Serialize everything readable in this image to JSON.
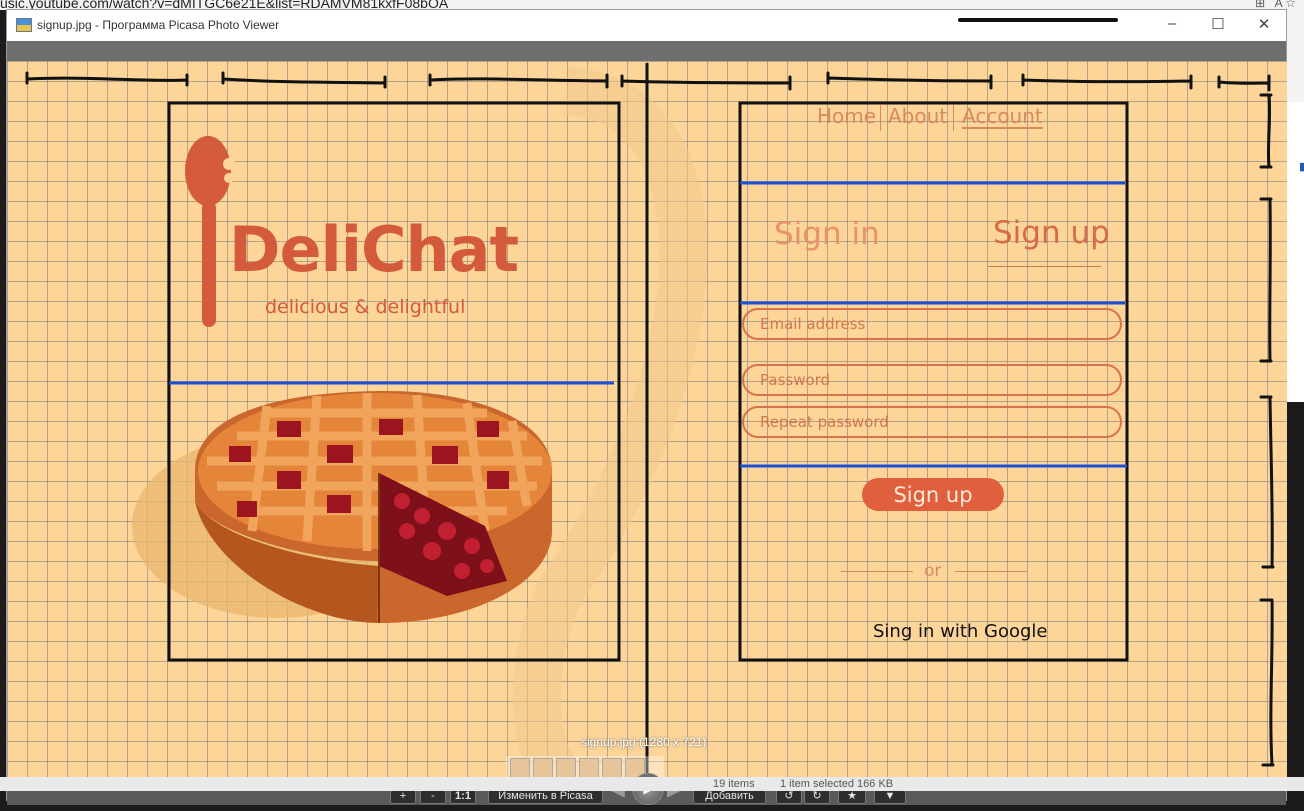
{
  "browser": {
    "url": "usic.youtube.com/watch?v=dMITGC6e21E&list=RDAMVM81kxfF08bOA"
  },
  "window": {
    "title": "signup.jpg - Программа Picasa Photo Viewer",
    "controls": {
      "minimize": "–",
      "maximize": "☐",
      "close": "✕"
    }
  },
  "sketch": {
    "logo": {
      "name": "DeliChat",
      "tagline": "delicious & delightful"
    },
    "nav": {
      "home": "Home",
      "about": "About",
      "account": "Account"
    },
    "tabs": {
      "sign_in": "Sign in",
      "sign_up": "Sign up"
    },
    "form": {
      "email_placeholder": "Email address",
      "password_placeholder": "Password",
      "repeat_password_placeholder": "Repeat password",
      "submit_label": "Sign up"
    },
    "or_text": "or",
    "google_signin": "Sing in with Google"
  },
  "viewer": {
    "caption": "signup.jpg (1280 x 721)",
    "toolbar": {
      "zoom_in": "+",
      "zoom_out": "-",
      "actual_size": "1:1",
      "edit_in_picasa": "Изменить в Picasa",
      "play": "▶",
      "add": "Добавить",
      "rotate_left": "↺",
      "rotate_right": "↻",
      "star": "★",
      "more": "▼"
    }
  },
  "status": {
    "items": "19 items",
    "selected": "1 item selected  166 KB"
  },
  "colors": {
    "paper": "#fdd599",
    "accent": "#d35a3c",
    "divider_blue": "#1a4fd6"
  }
}
